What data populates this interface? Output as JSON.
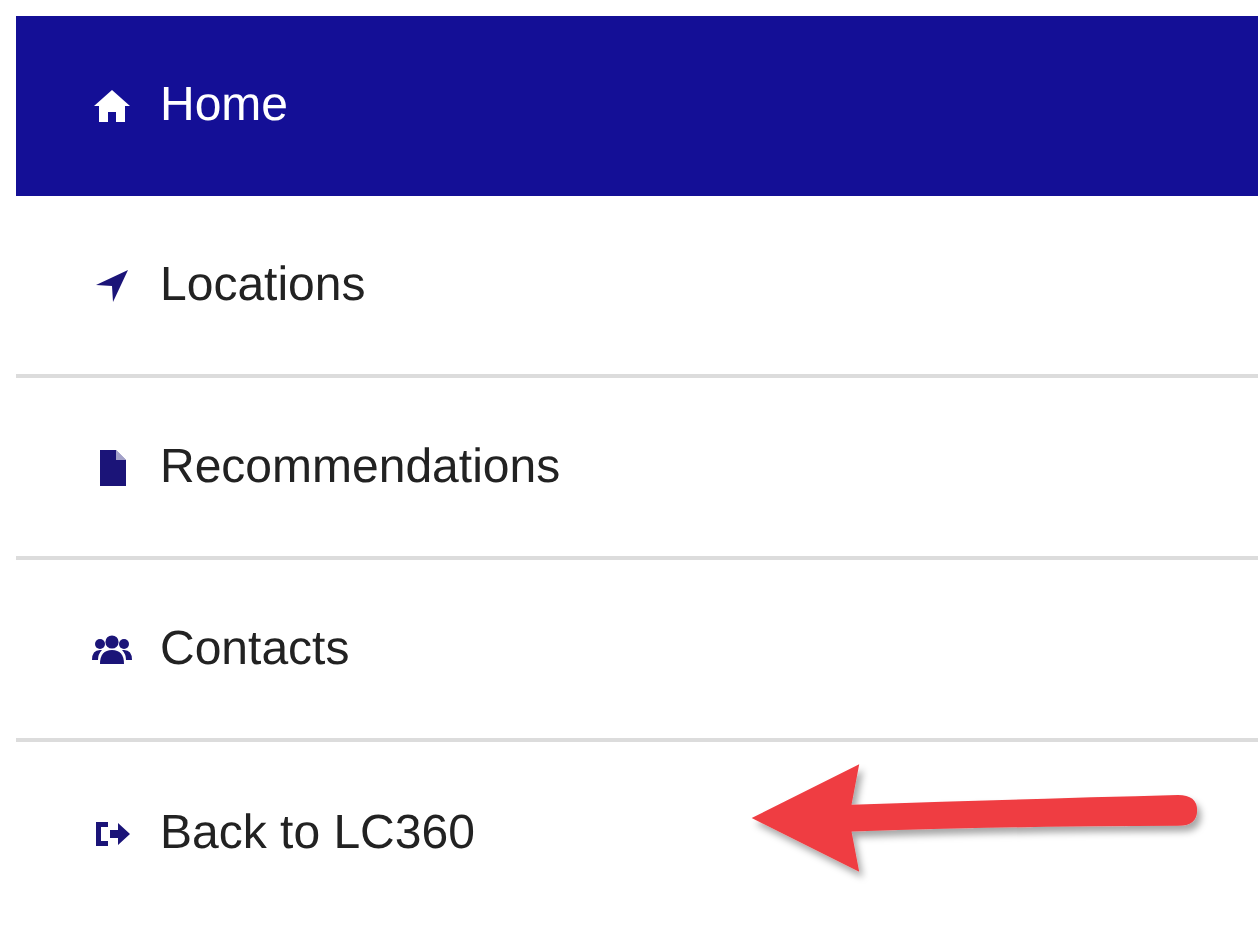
{
  "menu": {
    "items": [
      {
        "label": "Home",
        "selected": true
      },
      {
        "label": "Locations",
        "selected": false
      },
      {
        "label": "Recommendations",
        "selected": false
      },
      {
        "label": "Contacts",
        "selected": false
      },
      {
        "label": "Back to LC360",
        "selected": false
      }
    ]
  }
}
